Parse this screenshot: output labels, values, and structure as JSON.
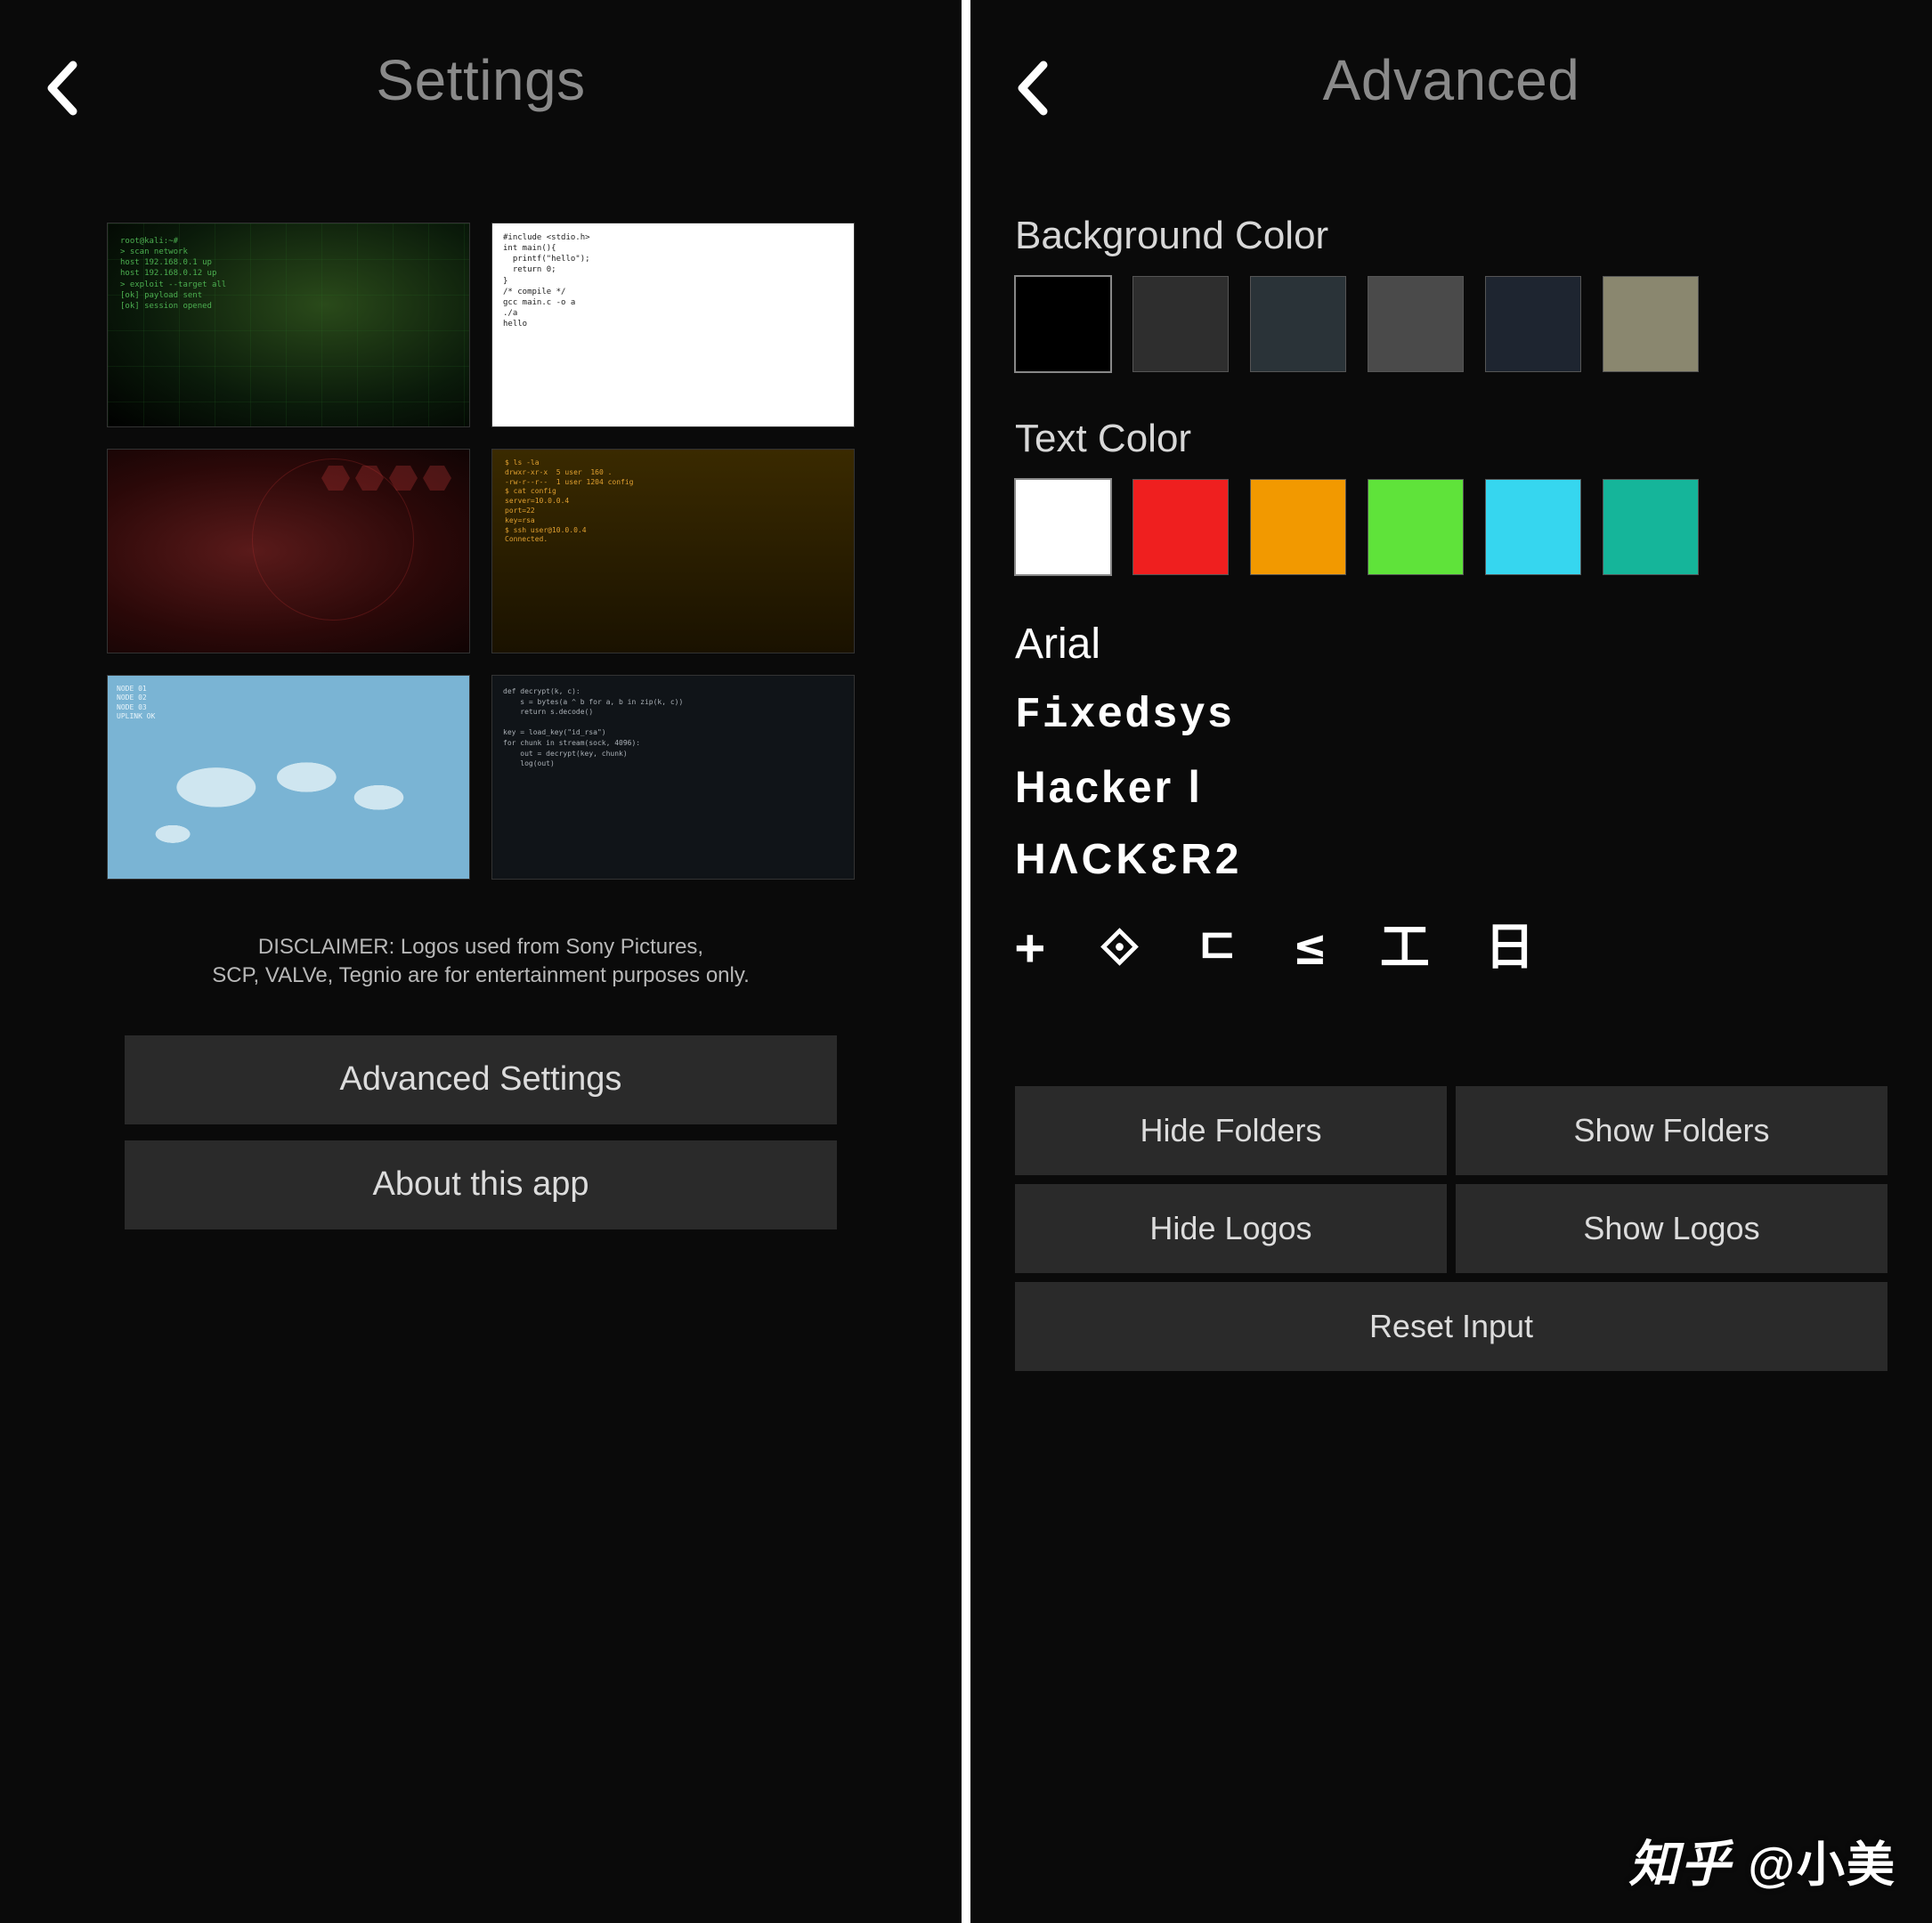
{
  "settings": {
    "title": "Settings",
    "disclaimer": "DISCLAIMER: Logos used from Sony Pictures,\nSCP, VALVe, Tegnio are for entertainment purposes only.",
    "buttons": {
      "advanced": "Advanced Settings",
      "about": "About this app"
    },
    "themes": [
      {
        "id": "green-map",
        "style": "thumb-green"
      },
      {
        "id": "white-terminal",
        "style": "thumb-white"
      },
      {
        "id": "red-hud",
        "style": "thumb-red"
      },
      {
        "id": "orange-terminal",
        "style": "thumb-orange"
      },
      {
        "id": "blue-map",
        "style": "thumb-blue"
      },
      {
        "id": "dark-terminal",
        "style": "thumb-dark"
      }
    ]
  },
  "advanced": {
    "title": "Advanced",
    "background_label": "Background Color",
    "text_label": "Text Color",
    "background_colors": [
      "#000000",
      "#2e2e2e",
      "#2a3338",
      "#4a4a4a",
      "#1e2530",
      "#8a876f"
    ],
    "background_selected_index": 0,
    "text_colors": [
      "#ffffff",
      "#ef1f1f",
      "#f29900",
      "#5fe33a",
      "#36d6ef",
      "#15b59a"
    ],
    "text_selected_index": 0,
    "fonts": [
      {
        "name": "Arial",
        "class": "font-arial"
      },
      {
        "name": "Fixedsys",
        "class": "font-fixedsys"
      },
      {
        "name": "Hacker1",
        "class": "font-hacker1",
        "display": "Hacker l"
      },
      {
        "name": "HACKER2",
        "class": "font-hacker2",
        "display": "HΛCKƐR2"
      },
      {
        "name": "Matrix",
        "class": "font-matrix",
        "display": "+ ⟐ ㄷ ≤ 工 日"
      }
    ],
    "buttons": {
      "hide_folders": "Hide Folders",
      "show_folders": "Show Folders",
      "hide_logos": "Hide Logos",
      "show_logos": "Show Logos",
      "reset_input": "Reset Input"
    }
  },
  "watermark": "知乎 @小美"
}
